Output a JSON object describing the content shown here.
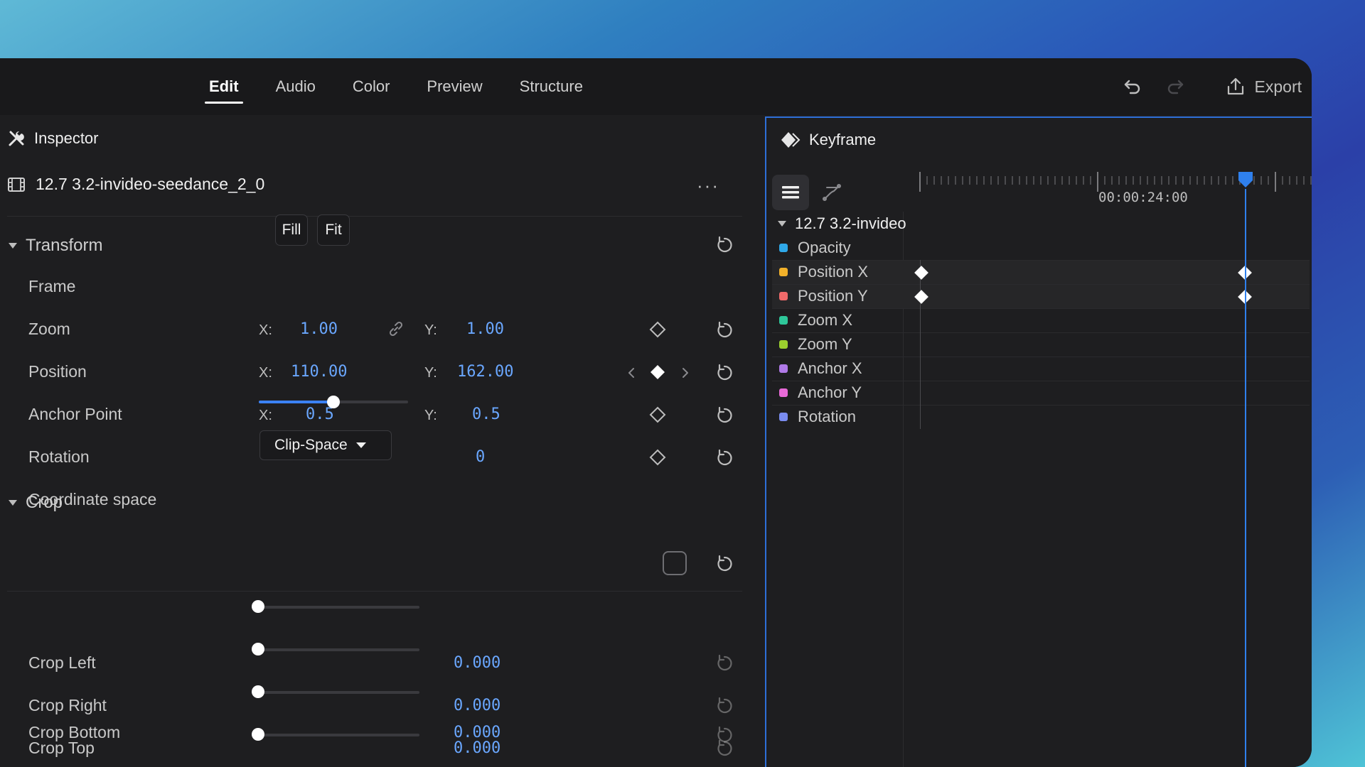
{
  "topbar": {
    "tabs": [
      {
        "label": "Edit",
        "active": true
      },
      {
        "label": "Audio",
        "active": false
      },
      {
        "label": "Color",
        "active": false
      },
      {
        "label": "Preview",
        "active": false
      },
      {
        "label": "Structure",
        "active": false
      }
    ],
    "undo_icon": "undo-icon",
    "redo_icon": "redo-icon",
    "export_label": "Export"
  },
  "inspector": {
    "title": "Inspector",
    "clip_name": "12.7 3.2-invideo-seedance_2_0",
    "more_label": "···",
    "transform": {
      "title": "Transform",
      "frame": {
        "label": "Frame",
        "fill_label": "Fill",
        "fit_label": "Fit"
      },
      "zoom": {
        "label": "Zoom",
        "x_label": "X:",
        "x": "1.00",
        "y_label": "Y:",
        "y": "1.00"
      },
      "position": {
        "label": "Position",
        "x_label": "X:",
        "x": "110.00",
        "y_label": "Y:",
        "y": "162.00"
      },
      "anchor": {
        "label": "Anchor Point",
        "x_label": "X:",
        "x": "0.5",
        "y_label": "Y:",
        "y": "0.5"
      },
      "rotation": {
        "label": "Rotation",
        "value": "0",
        "slider_fraction": 0.5
      },
      "coordinate_space": {
        "label": "Coordinate space",
        "value": "Clip-Space"
      }
    },
    "crop": {
      "title": "Crop",
      "left": {
        "label": "Crop Left",
        "value": "0.000"
      },
      "right": {
        "label": "Crop Right",
        "value": "0.000"
      },
      "top": {
        "label": "Crop Top",
        "value": "0.000"
      },
      "bottom": {
        "label": "Crop Bottom",
        "value": "0.000"
      }
    }
  },
  "keyframe": {
    "title": "Keyframe",
    "timecode": "00:00:24:00",
    "clip": "12.7 3.2-invideo",
    "tracks": [
      {
        "label": "Opacity",
        "color": "#2fa8e8"
      },
      {
        "label": "Position X",
        "color": "#f2b12a"
      },
      {
        "label": "Position Y",
        "color": "#f06a6a"
      },
      {
        "label": "Zoom X",
        "color": "#2ec79a"
      },
      {
        "label": "Zoom Y",
        "color": "#9bd02e"
      },
      {
        "label": "Anchor X",
        "color": "#b07ae8"
      },
      {
        "label": "Anchor Y",
        "color": "#e86ad8"
      },
      {
        "label": "Rotation",
        "color": "#7a8cf0"
      }
    ]
  },
  "colors": {
    "accent": "#2f80ed",
    "value_blue": "#6aa7ff"
  }
}
